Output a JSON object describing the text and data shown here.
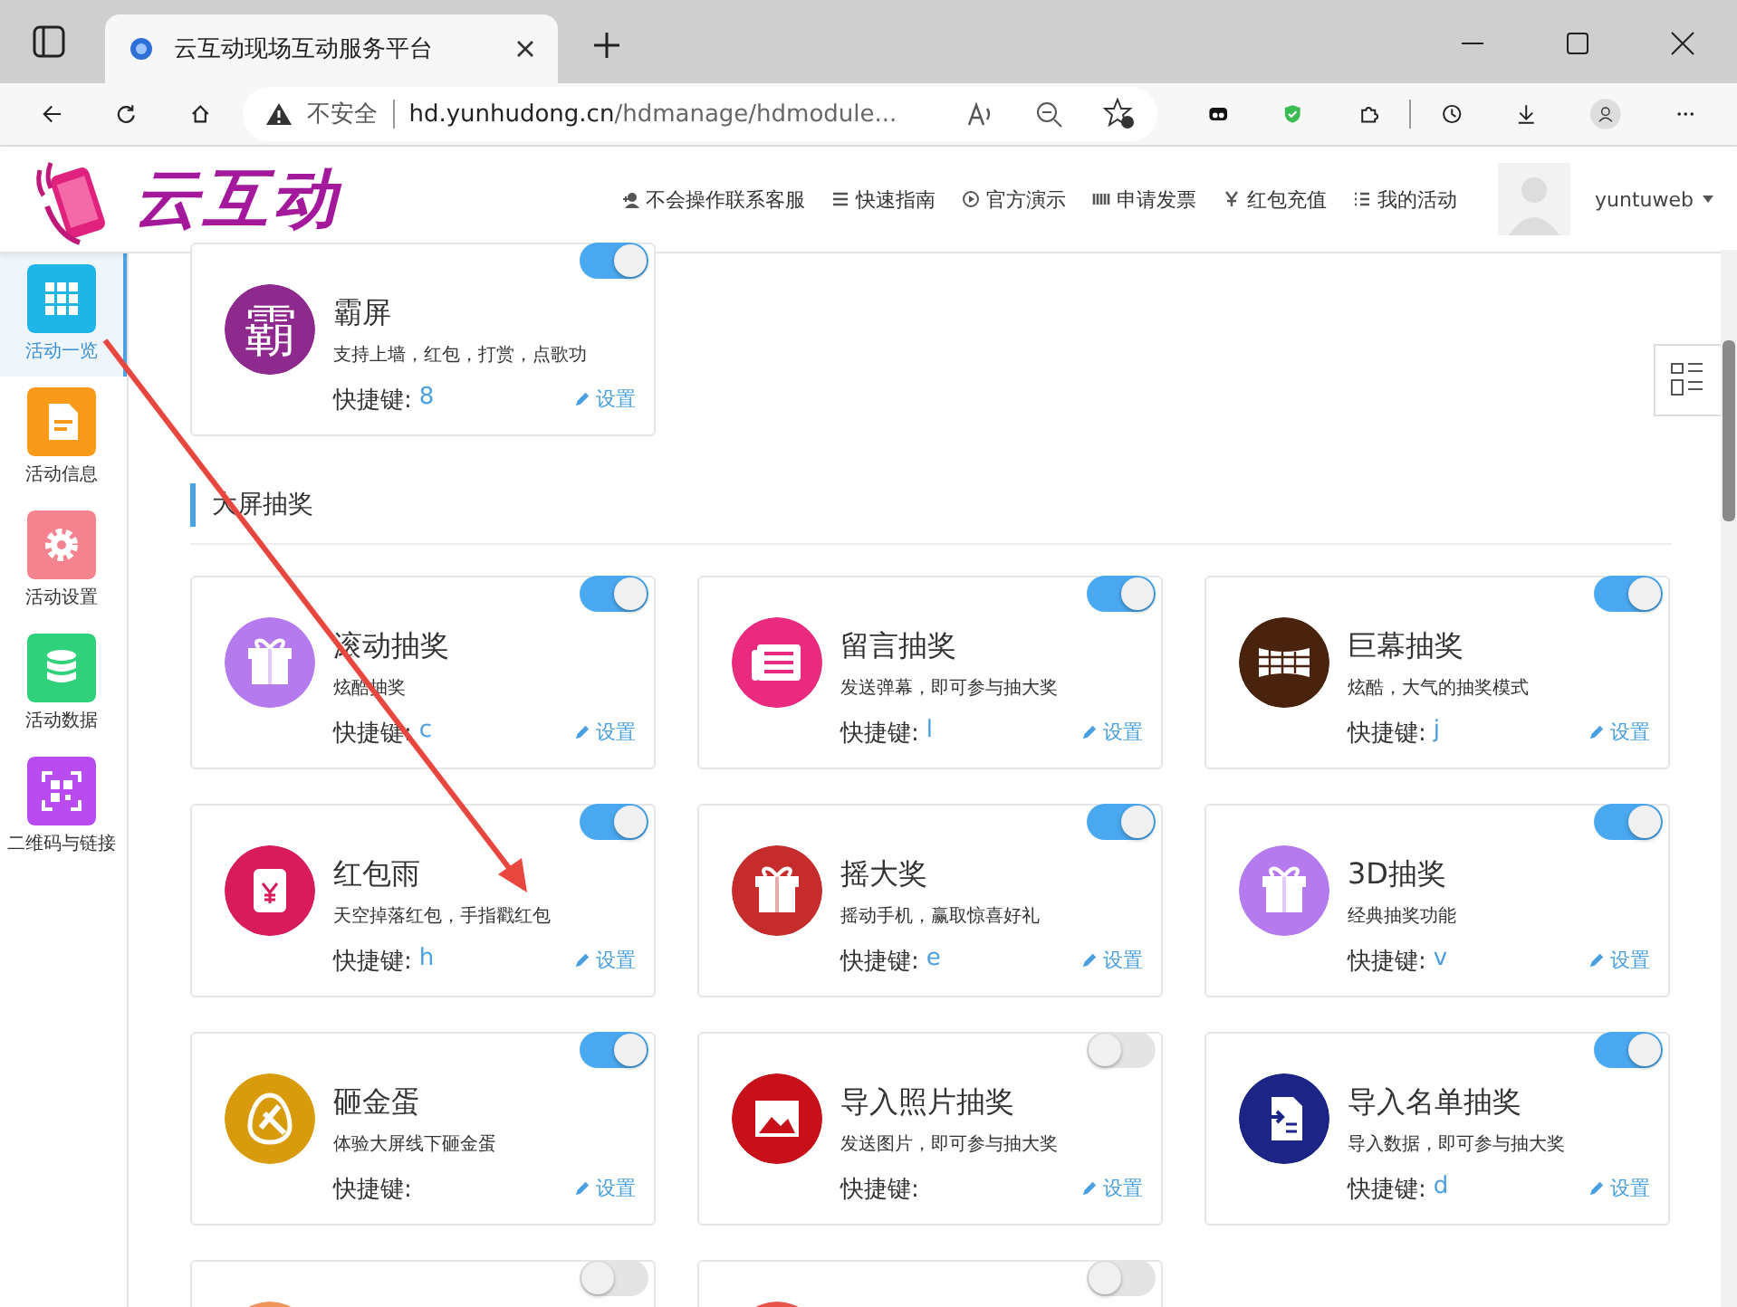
{
  "browser": {
    "tab_title": "云互动现场互动服务平台",
    "security": "不安全",
    "url_host": "hd.yunhudong.cn",
    "url_path": "/hdmanage/hdmodule..."
  },
  "header": {
    "logo": "云互动",
    "nav": [
      {
        "kind": "user-plus",
        "label": "不会操作联系客服"
      },
      {
        "kind": "lines",
        "label": "快速指南"
      },
      {
        "kind": "play",
        "label": "官方演示"
      },
      {
        "kind": "barcode",
        "label": "申请发票"
      },
      {
        "kind": "yen",
        "label": "红包充值"
      },
      {
        "kind": "list",
        "label": "我的活动"
      }
    ],
    "user": "yuntuweb"
  },
  "sidebar": [
    {
      "label": "活动一览",
      "kind": "grid",
      "color": "#1fb5e6",
      "selected": true
    },
    {
      "label": "活动信息",
      "kind": "doc",
      "color": "#fa9a1a",
      "selected": false
    },
    {
      "label": "活动设置",
      "kind": "gear",
      "color": "#f4838f",
      "selected": false
    },
    {
      "label": "活动数据",
      "kind": "database",
      "color": "#2fd17a",
      "selected": false
    },
    {
      "label": "二维码与链接",
      "kind": "qr",
      "color": "#b84cf0",
      "selected": false
    }
  ],
  "top_cards": [
    {
      "kind": "char",
      "glyph": "霸",
      "color": "#8e2a8e",
      "title": "霸屏",
      "desc": "支持上墙，红包，打赏，点歌功",
      "shortcut_label": "快捷键:",
      "key": "8",
      "settings": "设置",
      "on": true
    }
  ],
  "section": {
    "title": "大屏抽奖",
    "cards": [
      {
        "kind": "gift",
        "color": "#b57bee",
        "title": "滚动抽奖",
        "desc": "炫酷抽奖",
        "shortcut_label": "快捷键:",
        "key": "c",
        "settings": "设置",
        "on": true
      },
      {
        "kind": "news",
        "color": "#e92a7f",
        "title": "留言抽奖",
        "desc": "发送弹幕，即可参与抽大奖",
        "shortcut_label": "快捷键:",
        "key": "l",
        "settings": "设置",
        "on": true
      },
      {
        "kind": "screen",
        "color": "#4a230f",
        "title": "巨幕抽奖",
        "desc": "炫酷，大气的抽奖模式",
        "shortcut_label": "快捷键:",
        "key": "j",
        "settings": "设置",
        "on": true
      },
      {
        "kind": "packet",
        "color": "#d81b5a",
        "title": "红包雨",
        "desc": "天空掉落红包，手指戳红包",
        "shortcut_label": "快捷键:",
        "key": "h",
        "settings": "设置",
        "on": true
      },
      {
        "kind": "gift",
        "color": "#c62c2c",
        "title": "摇大奖",
        "desc": "摇动手机，赢取惊喜好礼",
        "shortcut_label": "快捷键:",
        "key": "e",
        "settings": "设置",
        "on": true
      },
      {
        "kind": "gift",
        "color": "#b57bee",
        "title": "3D抽奖",
        "desc": "经典抽奖功能",
        "shortcut_label": "快捷键:",
        "key": "v",
        "settings": "设置",
        "on": true
      },
      {
        "kind": "egg",
        "color": "#d89b0c",
        "title": "砸金蛋",
        "desc": "体验大屏线下砸金蛋",
        "shortcut_label": "快捷键:",
        "settings": "设置",
        "on": true
      },
      {
        "kind": "photo",
        "color": "#c8101b",
        "title": "导入照片抽奖",
        "desc": "发送图片，即可参与抽大奖",
        "shortcut_label": "快捷键:",
        "settings": "设置",
        "on": false
      },
      {
        "kind": "doc",
        "color": "#1c2585",
        "title": "导入名单抽奖",
        "desc": "导入数据，即可参与抽大奖",
        "shortcut_label": "快捷键:",
        "key": "d",
        "settings": "设置",
        "on": true
      },
      {
        "kind": "blank",
        "color": "#f0955a",
        "on": false
      },
      {
        "kind": "blank",
        "color": "#e8544a",
        "on": false
      }
    ]
  }
}
